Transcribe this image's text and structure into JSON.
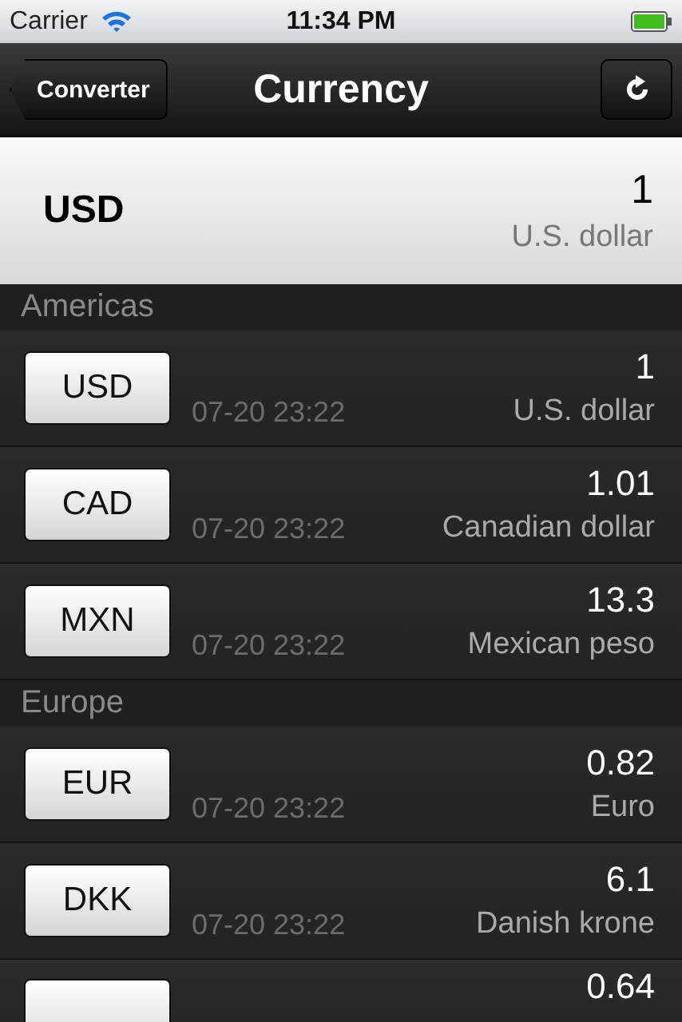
{
  "status_bar": {
    "carrier": "Carrier",
    "time": "11:34 PM"
  },
  "nav_bar": {
    "back": "Converter",
    "title": "Currency"
  },
  "base": {
    "code": "USD",
    "amount": "1",
    "name": "U.S. dollar"
  },
  "sections": [
    {
      "title": "Americas",
      "rows": [
        {
          "code": "USD",
          "updated": "07-20 23:22",
          "amount": "1",
          "name": "U.S. dollar"
        },
        {
          "code": "CAD",
          "updated": "07-20 23:22",
          "amount": "1.01",
          "name": "Canadian dollar"
        },
        {
          "code": "MXN",
          "updated": "07-20 23:22",
          "amount": "13.3",
          "name": "Mexican peso"
        }
      ]
    },
    {
      "title": "Europe",
      "rows": [
        {
          "code": "EUR",
          "updated": "07-20 23:22",
          "amount": "0.82",
          "name": "Euro"
        },
        {
          "code": "DKK",
          "updated": "07-20 23:22",
          "amount": "6.1",
          "name": "Danish krone"
        },
        {
          "amount": "0.64"
        }
      ]
    }
  ]
}
